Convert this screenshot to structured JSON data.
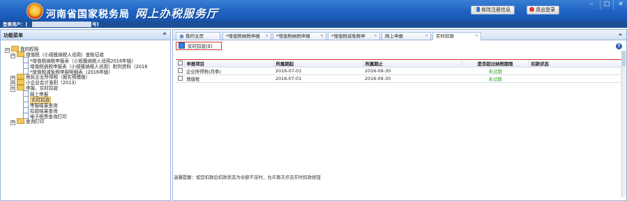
{
  "header": {
    "agency": "河南省国家税务局",
    "service": "网上办税服务厅",
    "buttons": {
      "change_password": "修改注册信息",
      "logout": "退出登录"
    },
    "window_controls": {
      "minimize": "–",
      "maximize": "□",
      "close": "×"
    }
  },
  "userbar": {
    "label": "登录用户：[",
    "tail": "号]"
  },
  "sidebar": {
    "title": "功能菜单",
    "collapse": "«",
    "tree": [
      {
        "level": 0,
        "expander": "⊟",
        "icon": "folder",
        "label": "我的权限"
      },
      {
        "level": 1,
        "expander": "⊟",
        "icon": "folder",
        "label": "增值税（小规模纳税人适用）查账征收"
      },
      {
        "level": 2,
        "expander": "",
        "icon": "doc",
        "label": "*增值税纳税申报表（小规模纳税人适用2016年版）"
      },
      {
        "level": 2,
        "expander": "",
        "icon": "doc",
        "label": "增值税纳税申报表（小规模纳税人适用）附列资料（2016"
      },
      {
        "level": 2,
        "expander": "",
        "icon": "doc",
        "label": "*增值税减免税申报明细表（2016年版）"
      },
      {
        "level": 1,
        "expander": "⊞",
        "icon": "folder",
        "label": "居民企业所得税（据实预缴版）"
      },
      {
        "level": 1,
        "expander": "⊞",
        "icon": "folder",
        "label": "小企业会计准则（2013）"
      },
      {
        "level": 1,
        "expander": "⊟",
        "icon": "folder",
        "label": "申报、实时扣款"
      },
      {
        "level": 2,
        "expander": "",
        "icon": "doc",
        "label": "网上申报"
      },
      {
        "level": 2,
        "expander": "",
        "icon": "doc",
        "label": "实时扣款",
        "selected": true
      },
      {
        "level": 2,
        "expander": "",
        "icon": "doc",
        "label": "申报结果查询"
      },
      {
        "level": 2,
        "expander": "",
        "icon": "doc",
        "label": "扣款结果查询"
      },
      {
        "level": 2,
        "expander": "",
        "icon": "doc",
        "label": "电子税票查询打印"
      },
      {
        "level": 1,
        "expander": "⊞",
        "icon": "folder",
        "label": "查询打印"
      }
    ]
  },
  "tabs": [
    {
      "label": "我的主页",
      "closable": false,
      "home": true
    },
    {
      "label": "*增值税纳税申报",
      "closable": true
    },
    {
      "label": "*增值税纳税申报",
      "closable": true
    },
    {
      "label": "*增值税减免税申",
      "closable": true
    },
    {
      "label": "网上申报",
      "closable": true
    },
    {
      "label": "实时扣款",
      "closable": true,
      "active": true
    }
  ],
  "tabs_more": "»",
  "toolbar": {
    "deduct_button": "实时扣款(E)",
    "help": "?"
  },
  "table": {
    "headers": [
      "",
      "申报项目",
      "所属期起",
      "所属期止",
      "是否超过纳税期限",
      "扣款状态"
    ],
    "rows": [
      {
        "item": "企业所得税(月季)",
        "start": "2016-07-01",
        "end": "2016-09-30",
        "overdue": "未过期",
        "status": ""
      },
      {
        "item": "增值税",
        "start": "2016-07-01",
        "end": "2016-09-30",
        "overdue": "未过期",
        "status": ""
      }
    ]
  },
  "notice": "温馨提醒：如您扣款后扣款状态为余额不足时，允许再次点击实时扣款按钮",
  "colors": {
    "banner": "#1f63c2",
    "accent_red": "#d6352a",
    "ok_green": "#2f9a22"
  }
}
